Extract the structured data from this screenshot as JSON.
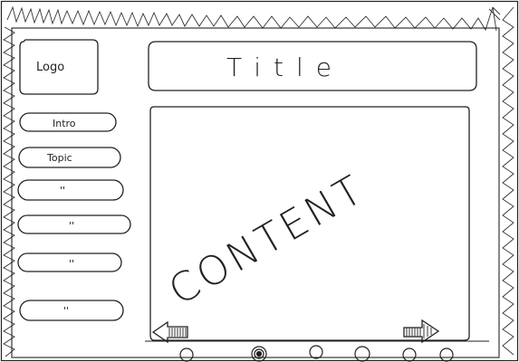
{
  "header": {
    "logo_label": "Logo",
    "title": "Title"
  },
  "sidebar": {
    "items": [
      {
        "label": "Intro"
      },
      {
        "label": "Topic"
      },
      {
        "label": "''"
      },
      {
        "label": "''"
      },
      {
        "label": "''"
      },
      {
        "label": "''"
      }
    ]
  },
  "main": {
    "content_label": "CONTENT"
  },
  "icons": {
    "prev": "left-arrow-icon",
    "next": "right-arrow-icon",
    "pager": [
      "circle-icon",
      "filled-circle-icon",
      "circle-icon",
      "circle-icon",
      "circle-icon",
      "circle-icon"
    ]
  }
}
